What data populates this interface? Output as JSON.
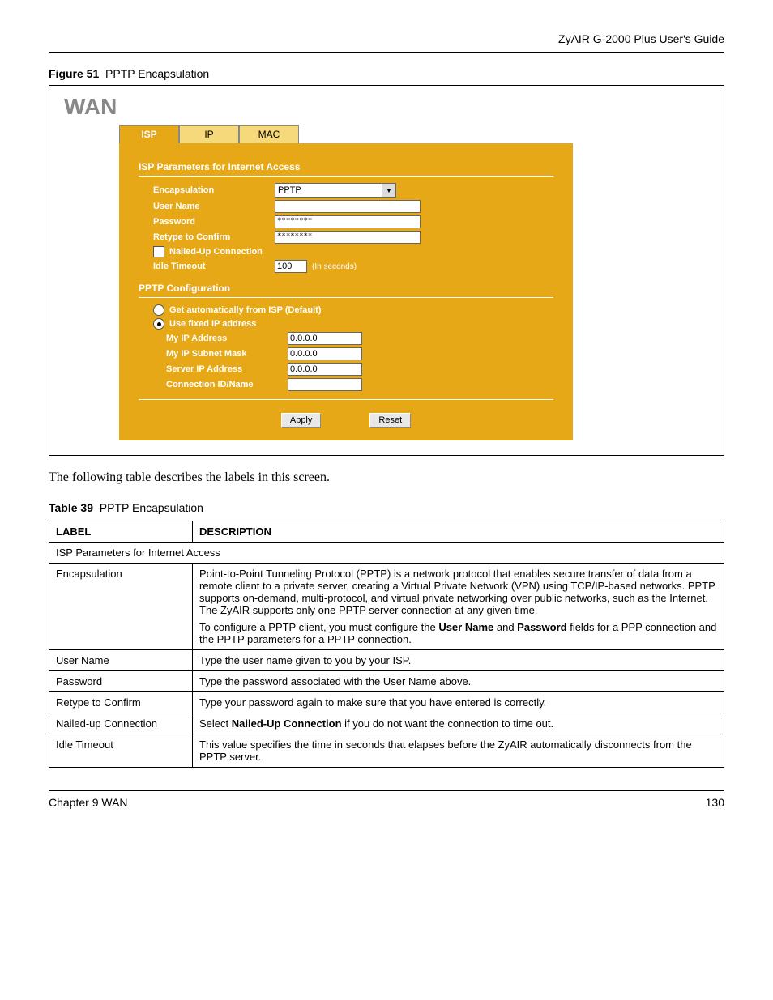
{
  "header": {
    "doc_title": "ZyAIR G-2000 Plus User's Guide"
  },
  "figure": {
    "label": "Figure 51",
    "title": "PPTP Encapsulation"
  },
  "app": {
    "page_title": "WAN",
    "tabs": {
      "isp": "ISP",
      "ip": "IP",
      "mac": "MAC"
    },
    "section1_heading": "ISP Parameters for Internet Access",
    "encapsulation": {
      "label": "Encapsulation",
      "value": "PPTP"
    },
    "username": {
      "label": "User Name",
      "value": ""
    },
    "password": {
      "label": "Password",
      "value": "********"
    },
    "retype": {
      "label": "Retype to Confirm",
      "value": "********"
    },
    "nailed": {
      "label": "Nailed-Up Connection",
      "checked": false
    },
    "idle": {
      "label": "Idle Timeout",
      "value": "100",
      "note": "(In seconds)"
    },
    "section2_heading": "PPTP Configuration",
    "radio_auto": {
      "label": "Get automatically from ISP (Default)",
      "selected": false
    },
    "radio_fixed": {
      "label": "Use fixed IP address",
      "selected": true
    },
    "my_ip": {
      "label": "My IP Address",
      "value": "0.0.0.0"
    },
    "my_subnet": {
      "label": "My IP Subnet Mask",
      "value": "0.0.0.0"
    },
    "server_ip": {
      "label": "Server IP Address",
      "value": "0.0.0.0"
    },
    "conn_id": {
      "label": "Connection ID/Name",
      "value": ""
    },
    "buttons": {
      "apply": "Apply",
      "reset": "Reset"
    }
  },
  "body_text": "The following table describes the labels in this screen.",
  "table": {
    "label": "Table 39",
    "title": "PPTP Encapsulation",
    "header_label": "LABEL",
    "header_desc": "DESCRIPTION",
    "section_row": "ISP Parameters for Internet Access",
    "rows": [
      {
        "label": "Encapsulation",
        "desc_p1": "Point-to-Point Tunneling Protocol (PPTP) is a network protocol that enables secure transfer of data from a remote client to a private server, creating a Virtual Private Network (VPN) using TCP/IP-based networks. PPTP supports on-demand, multi-protocol, and virtual private networking over public networks, such as the Internet. The ZyAIR supports only one PPTP server connection at any given time.",
        "desc_p2_a": "To configure a PPTP client, you must configure the ",
        "desc_p2_b1": "User Name",
        "desc_p2_c": " and ",
        "desc_p2_b2": "Password",
        "desc_p2_d": " fields for a PPP connection and the PPTP parameters for a PPTP connection."
      },
      {
        "label": "User Name",
        "desc": "Type the user name given to you by your ISP."
      },
      {
        "label": "Password",
        "desc": "Type the password associated with the User Name above."
      },
      {
        "label": "Retype to Confirm",
        "desc": "Type your password again to make sure that you have entered is correctly."
      },
      {
        "label": "Nailed-up Connection",
        "desc_a": "Select ",
        "desc_b": "Nailed-Up Connection",
        "desc_c": " if you do not want the connection to time out."
      },
      {
        "label": "Idle Timeout",
        "desc": "This value specifies the time in seconds that elapses before the ZyAIR automatically disconnects from the PPTP server."
      }
    ]
  },
  "footer": {
    "chapter": "Chapter 9 WAN",
    "page": "130"
  }
}
